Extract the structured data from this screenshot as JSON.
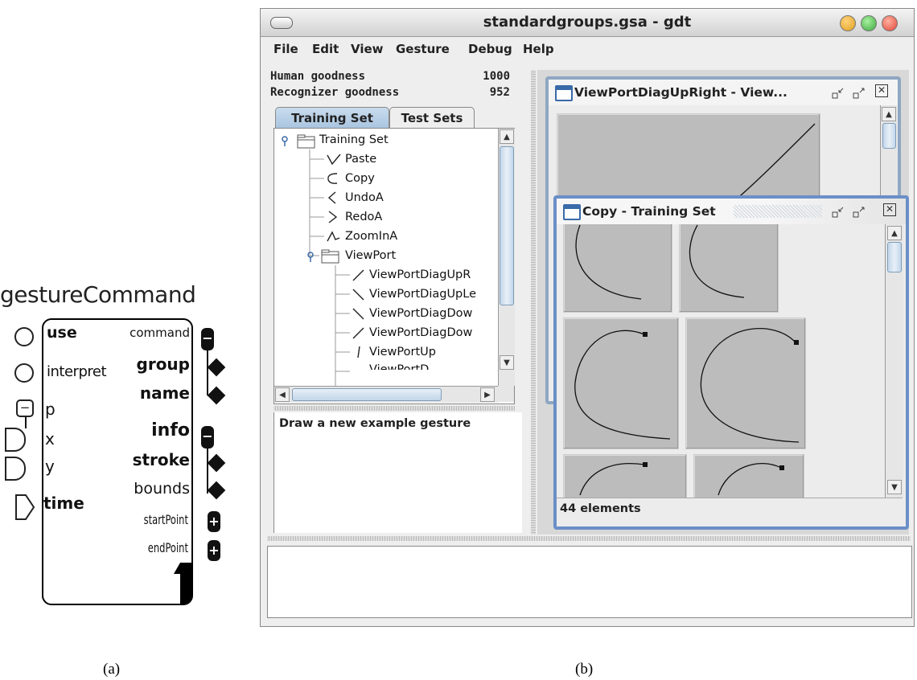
{
  "gesture_command": {
    "title": "gestureCommand",
    "inputs": [
      {
        "label": "use",
        "shape": "circle"
      },
      {
        "label": "interpret",
        "shape": "circle"
      },
      {
        "label": "p",
        "shape": "minus"
      },
      {
        "label": "x",
        "shape": "d-shape"
      },
      {
        "label": "y",
        "shape": "d-shape"
      },
      {
        "label": "time",
        "shape": "triangle"
      }
    ],
    "outputs": [
      {
        "label": "command",
        "shape": "minus-pill"
      },
      {
        "label": "group",
        "shape": "diamond"
      },
      {
        "label": "name",
        "shape": "diamond"
      },
      {
        "label": "info",
        "shape": "minus-pill"
      },
      {
        "label": "stroke",
        "shape": "diamond"
      },
      {
        "label": "bounds",
        "shape": "diamond"
      },
      {
        "label": "startPoint",
        "shape": "plus-pill"
      },
      {
        "label": "endPoint",
        "shape": "plus-pill"
      }
    ],
    "minus_glyph": "−",
    "plus_glyph": "+"
  },
  "captions": {
    "a": "(a)",
    "b": "(b)"
  },
  "window": {
    "title": "standardgroups.gsa - gdt",
    "menu": [
      "File",
      "Edit",
      "View",
      "Gesture",
      "Debug",
      "Help"
    ],
    "stats": [
      {
        "label": "Human goodness",
        "value": "1000"
      },
      {
        "label": "Recognizer goodness",
        "value": "952"
      }
    ],
    "tabs": [
      "Training Set",
      "Test Sets"
    ],
    "tree": {
      "root": "Training Set",
      "items": [
        "Paste",
        "Copy",
        "UndoA",
        "RedoA",
        "ZoomInA"
      ],
      "folder": "ViewPort",
      "sub_items": [
        "ViewPortDiagUpR",
        "ViewPortDiagUpLe",
        "ViewPortDiagDow",
        "ViewPortDiagDow",
        "ViewPortUp",
        "ViewPortD"
      ]
    },
    "status_message": "Draw a new example gesture",
    "frame1": {
      "title": "ViewPortDiagUpRight - View..."
    },
    "frame2": {
      "title": "Copy - Training Set",
      "footer": "44 elements"
    },
    "frame_buttons": {
      "minimize": "▫↙",
      "maximize": "▫↗",
      "close": "✕"
    },
    "scroll_arrows": {
      "up": "▲",
      "down": "▼",
      "left": "◀",
      "right": "▶"
    },
    "colors": {
      "active_tab": "#b8d0e8",
      "frame_border": "#6b8fc7",
      "traffic_red": "#e0483a",
      "traffic_yellow": "#e6b020",
      "traffic_green": "#3ca83c"
    }
  }
}
